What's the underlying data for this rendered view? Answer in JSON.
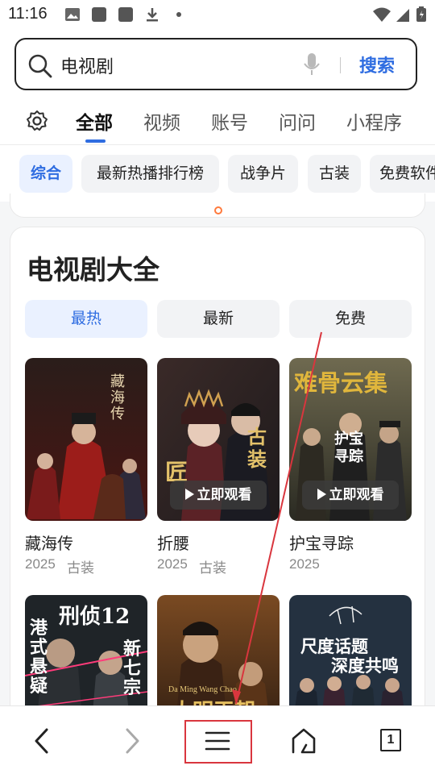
{
  "status_bar": {
    "time": "11:16"
  },
  "search": {
    "query": "电视剧",
    "button_label": "搜索"
  },
  "tabs": [
    {
      "label": "全部",
      "active": true
    },
    {
      "label": "视频"
    },
    {
      "label": "账号"
    },
    {
      "label": "问问"
    },
    {
      "label": "小程序"
    }
  ],
  "chips": [
    {
      "label": "综合",
      "active": true
    },
    {
      "label": "最新热播排行榜"
    },
    {
      "label": "战争片"
    },
    {
      "label": "古装"
    },
    {
      "label": "免费软件"
    }
  ],
  "card": {
    "title": "电视剧大全",
    "filters": [
      {
        "label": "最热",
        "active": true
      },
      {
        "label": "最新"
      },
      {
        "label": "免费"
      }
    ],
    "watch_label": "立即观看",
    "items": [
      {
        "title": "藏海传",
        "year": "2025",
        "genre": "古装",
        "poster_text": "藏海传"
      },
      {
        "title": "折腰",
        "year": "2025",
        "genre": "古装",
        "poster_text_1": "古装",
        "poster_text_2": "匠"
      },
      {
        "title": "护宝寻踪",
        "year": "2025",
        "genre": "",
        "poster_text_1": "难骨云集",
        "poster_text_2": "护宝寻踪"
      },
      {
        "poster_text_1": "港式悬疑",
        "poster_text_2": "刑侦12",
        "poster_text_3": "新七宗"
      },
      {
        "poster_text_1": "大明王朝",
        "poster_text_2": "Da Ming Wang Chao"
      },
      {
        "poster_text_1": "尺度话题",
        "poster_text_2": "深度共鸣"
      }
    ]
  },
  "bottom_nav": {
    "items": [
      "back-icon",
      "forward-icon",
      "menu-icon",
      "home-icon",
      "tabs-icon"
    ],
    "tab_count": "1"
  },
  "colors": {
    "accent": "#2f6de1",
    "annotation": "#d9363e"
  }
}
